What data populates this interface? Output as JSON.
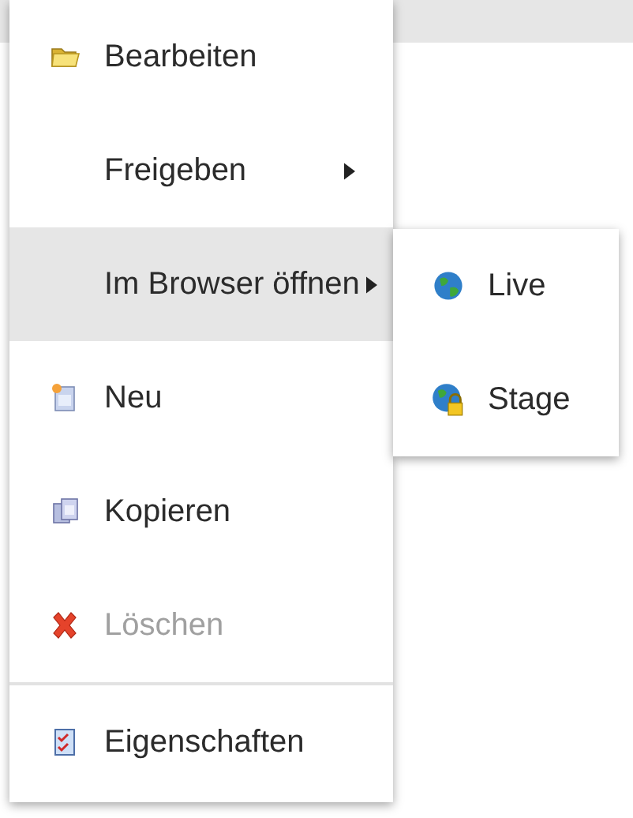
{
  "menu": {
    "items": [
      {
        "kind": "action",
        "label": "Bearbeiten",
        "selected": false,
        "disabled": false,
        "separator_before": false
      },
      {
        "kind": "submenu",
        "label": "Freigeben",
        "selected": false,
        "disabled": false,
        "separator_before": false
      },
      {
        "kind": "submenu",
        "label": "Im Browser öffnen",
        "selected": true,
        "disabled": false,
        "separator_before": false
      },
      {
        "kind": "action",
        "label": "Neu",
        "selected": false,
        "disabled": false,
        "separator_before": false
      },
      {
        "kind": "action",
        "label": "Kopieren",
        "selected": false,
        "disabled": false,
        "separator_before": false
      },
      {
        "kind": "action",
        "label": "Löschen",
        "selected": false,
        "disabled": true,
        "separator_before": false
      },
      {
        "kind": "action",
        "label": "Eigenschaften",
        "selected": false,
        "disabled": false,
        "separator_before": true
      }
    ]
  },
  "submenu": {
    "items": [
      {
        "label": "Live",
        "selected": false
      },
      {
        "label": "Stage",
        "selected": false
      }
    ]
  }
}
